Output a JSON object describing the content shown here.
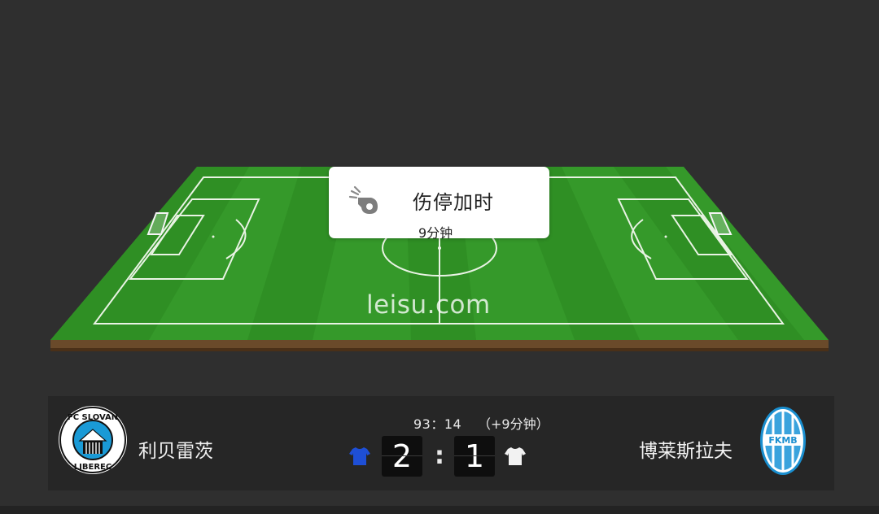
{
  "popup": {
    "title": "伤停加时",
    "subtitle": "9分钟",
    "icon": "whistle-icon"
  },
  "watermark": "leisu.com",
  "match": {
    "clock": "93：14",
    "added_time": "（+9分钟）",
    "home": {
      "name": "利贝雷茨",
      "score": "2",
      "logo_text_top": "FC SLOVAN",
      "logo_text_bottom": "LIBEREC",
      "shirt_color": "#1e4fd6"
    },
    "away": {
      "name": "博莱斯拉夫",
      "score": "1",
      "logo_text": "FKMB",
      "shirt_color": "#f2f2f2"
    },
    "separator": ":"
  },
  "colors": {
    "background": "#2f2f2f",
    "pitch_light": "#3aa12c",
    "pitch_dark": "#2f8e22",
    "scorebar": "#262626"
  }
}
